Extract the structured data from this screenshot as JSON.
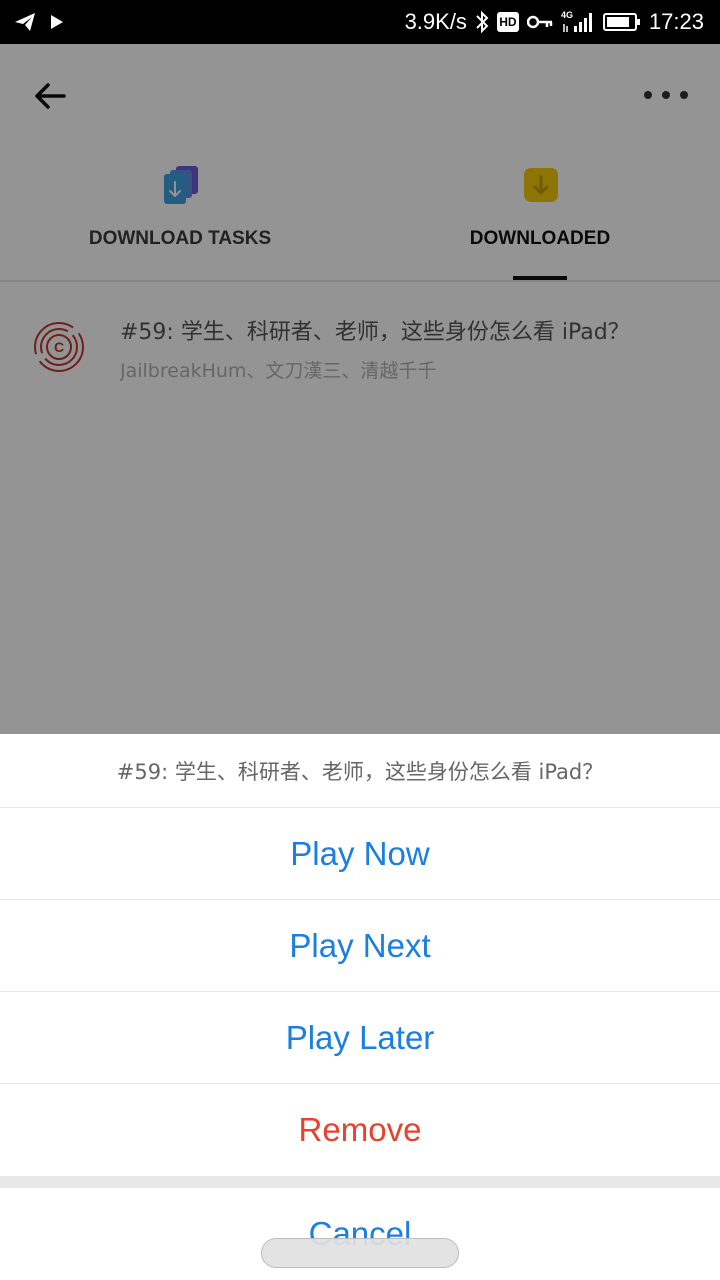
{
  "status_bar": {
    "left_icons": [
      "send-icon",
      "play-icon"
    ],
    "net_speed": "3.9K/s",
    "icons": [
      "bluetooth-icon",
      "hd-icon",
      "vpn-key-icon",
      "4g-signal-icon",
      "battery-icon"
    ],
    "hd_label": "HD",
    "network_label": "4G",
    "time": "17:23"
  },
  "toolbar": {
    "back_icon": "arrow-left-icon",
    "more_icon": "more-horizontal-icon"
  },
  "tabs": [
    {
      "label": "DOWNLOAD TASKS",
      "icon": "download-tasks-icon",
      "icon_color": "#4a7fd6",
      "selected": false
    },
    {
      "label": "DOWNLOADED",
      "icon": "downloaded-icon",
      "icon_color": "#f2c400",
      "selected": true
    }
  ],
  "downloaded_list": [
    {
      "logo": "podcast-logo-icon",
      "logo_letter": "C",
      "title": "#59: 学生、科研者、老师，这些身份怎么看 iPad？",
      "subtitle": "JailbreakHum、文刀漢三、清越千千"
    }
  ],
  "action_sheet": {
    "title": "#59: 学生、科研者、老师，这些身份怎么看 iPad？",
    "actions": {
      "play_now": "Play Now",
      "play_next": "Play Next",
      "play_later": "Play Later",
      "remove": "Remove",
      "cancel": "Cancel"
    }
  },
  "colors": {
    "action_blue": "#1a7fe0",
    "destructive_red": "#e8412c",
    "overlay": "rgba(0,0,0,0.42)"
  }
}
